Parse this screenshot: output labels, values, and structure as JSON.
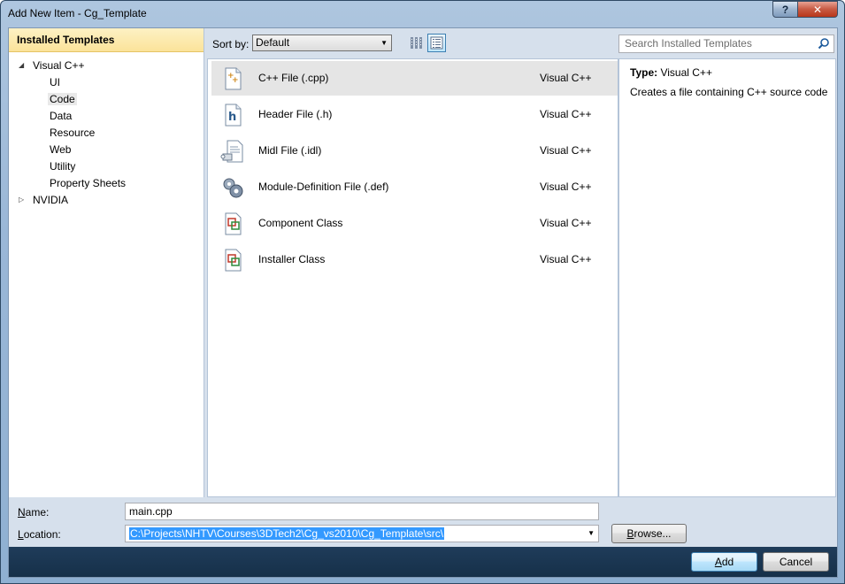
{
  "window": {
    "title": "Add New Item - Cg_Template",
    "help_label": "?",
    "close_label": "✕"
  },
  "left_panel": {
    "header": "Installed Templates",
    "tree": [
      {
        "label": "Visual C++",
        "expanded": true,
        "level": 0,
        "has_children": true
      },
      {
        "label": "UI",
        "level": 1
      },
      {
        "label": "Code",
        "level": 1,
        "selected": true
      },
      {
        "label": "Data",
        "level": 1
      },
      {
        "label": "Resource",
        "level": 1
      },
      {
        "label": "Web",
        "level": 1
      },
      {
        "label": "Utility",
        "level": 1
      },
      {
        "label": "Property Sheets",
        "level": 1
      },
      {
        "label": "NVIDIA",
        "expanded": false,
        "level": 0,
        "has_children": true
      }
    ]
  },
  "toolbar": {
    "sort_by_label": "Sort by:",
    "sort_by_value": "Default",
    "view_buttons": [
      {
        "icon": "medium-icons-view-icon",
        "active": false
      },
      {
        "icon": "details-view-icon",
        "active": true
      }
    ]
  },
  "search": {
    "placeholder": "Search Installed Templates"
  },
  "templates": [
    {
      "name": "C++ File (.cpp)",
      "language": "Visual C++",
      "icon": "cpp-file-icon",
      "selected": true
    },
    {
      "name": "Header File (.h)",
      "language": "Visual C++",
      "icon": "header-file-icon"
    },
    {
      "name": "Midl File (.idl)",
      "language": "Visual C++",
      "icon": "midl-file-icon"
    },
    {
      "name": "Module-Definition File (.def)",
      "language": "Visual C++",
      "icon": "module-definition-icon"
    },
    {
      "name": "Component Class",
      "language": "Visual C++",
      "icon": "component-class-icon"
    },
    {
      "name": "Installer Class",
      "language": "Visual C++",
      "icon": "installer-class-icon"
    }
  ],
  "details": {
    "type_label": "Type:",
    "type_value": "Visual C++",
    "description": "Creates a file containing C++ source code"
  },
  "form": {
    "name_label_mnemonic": "N",
    "name_label_rest": "ame:",
    "name_value": "main.cpp",
    "location_label_mnemonic": "L",
    "location_label_rest": "ocation:",
    "location_value": "C:\\Projects\\NHTV\\Courses\\3DTech2\\Cg_vs2010\\Cg_Template\\src\\",
    "browse_label_mnemonic": "B",
    "browse_label_rest": "rowse..."
  },
  "buttons": {
    "add_label_mnemonic": "A",
    "add_label_rest": "dd",
    "cancel_label": "Cancel"
  }
}
